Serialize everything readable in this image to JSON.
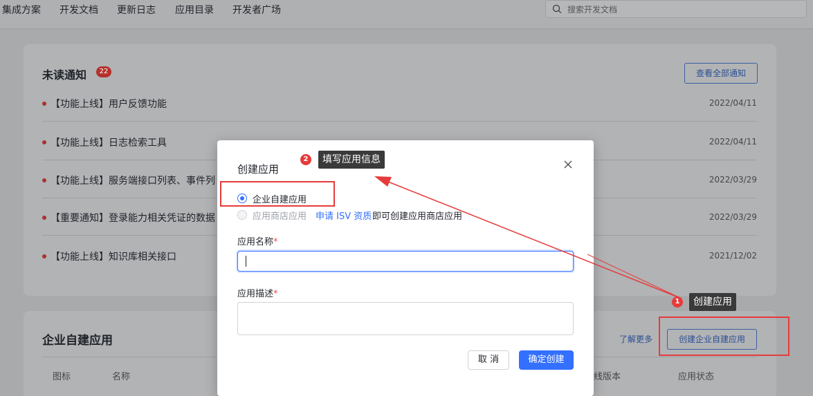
{
  "nav": {
    "items": [
      "集成方案",
      "开发文档",
      "更新日志",
      "应用目录",
      "开发者广场"
    ],
    "search_placeholder": "搜索开发文档"
  },
  "notices": {
    "title": "未读通知",
    "badge": "22",
    "view_all": "查看全部通知",
    "items": [
      {
        "text": "【功能上线】用户反馈功能",
        "date": "2022/04/11"
      },
      {
        "text": "【功能上线】日志检索工具",
        "date": "2022/04/11"
      },
      {
        "text": "【功能上线】服务端接口列表、事件列",
        "date": "2022/03/29"
      },
      {
        "text": "【重要通知】登录能力相关凭证的数据",
        "date": "2022/03/29"
      },
      {
        "text": "【功能上线】知识库相关接口",
        "date": "2021/12/02"
      }
    ]
  },
  "enterprise_apps": {
    "title": "企业自建应用",
    "learn_more": "了解更多",
    "create_button": "创建企业自建应用",
    "columns": [
      "图标",
      "名称",
      "线版本",
      "应用状态"
    ]
  },
  "modal": {
    "title": "创建应用",
    "option_enterprise": "企业自建应用",
    "option_store": "应用商店应用",
    "isv_link": "申请 ISV 资质",
    "isv_suffix": "即可创建应用商店应用",
    "name_label": "应用名称",
    "desc_label": "应用描述",
    "required_mark": "*",
    "cancel": "取 消",
    "confirm": "确定创建"
  },
  "annotations": {
    "step1_num": "1",
    "step1_label": "创建应用",
    "step2_num": "2",
    "step2_label": "填写应用信息",
    "color": "#e63b3b"
  },
  "colors": {
    "accent": "#3370ff",
    "mask_bg": "#a9aaac",
    "annotation_red": "#e63b3b"
  }
}
